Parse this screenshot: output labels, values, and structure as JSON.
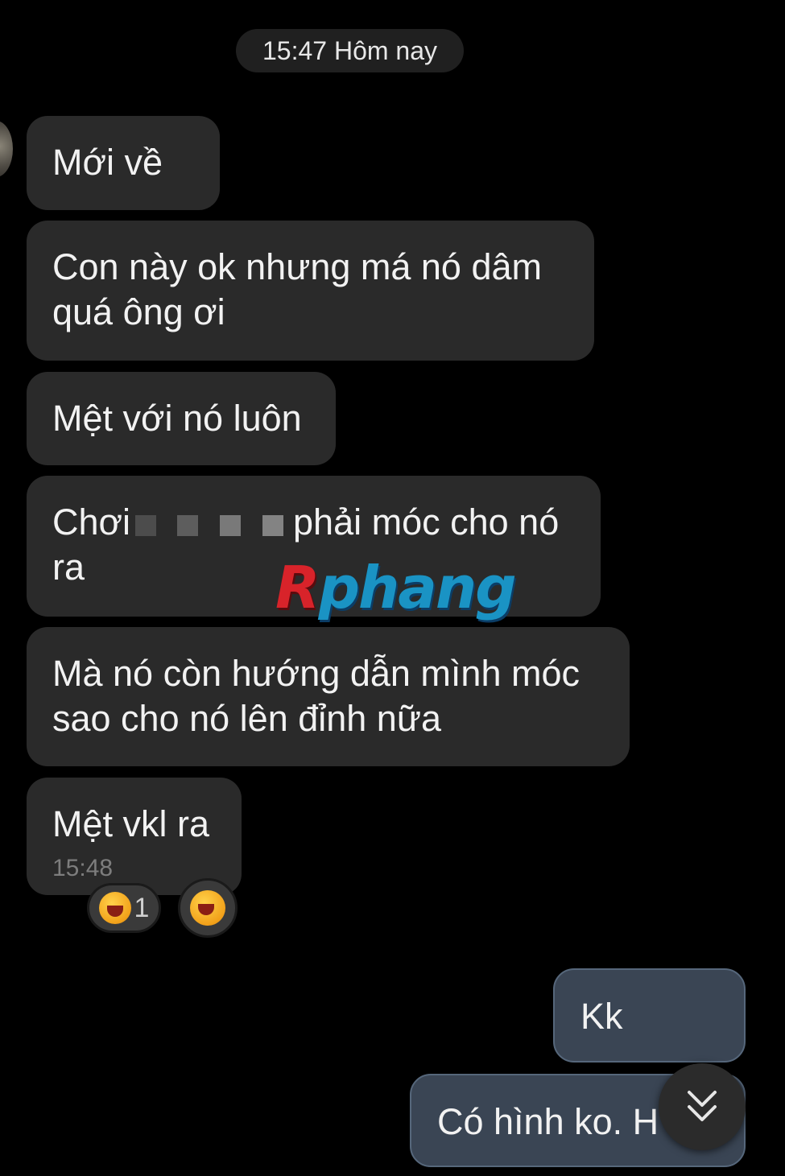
{
  "header": {
    "date_label": "15:47 Hôm nay"
  },
  "messages": [
    {
      "direction": "incoming",
      "text": "Mới về"
    },
    {
      "direction": "incoming",
      "text": "Con này ok nhưng má nó dâm quá ông ơi"
    },
    {
      "direction": "incoming",
      "text": "Mệt với nó luôn"
    },
    {
      "direction": "incoming",
      "text_before": "Chơi",
      "text_after": "phải móc cho nó ra",
      "censored": true
    },
    {
      "direction": "incoming",
      "text": "Mà nó còn hướng dẫn mình móc sao cho nó lên đỉnh nữa"
    },
    {
      "direction": "incoming",
      "text": "Mệt vkl ra",
      "time": "15:48"
    },
    {
      "direction": "outgoing",
      "text": "Kk"
    },
    {
      "direction": "outgoing",
      "text": "Có hình ko. H"
    }
  ],
  "reactions": [
    {
      "icon": "laughing-emoji-icon",
      "count": "1"
    },
    {
      "icon": "laughing-emoji-icon"
    }
  ],
  "watermark": {
    "first_letter": "R",
    "rest": "phang"
  },
  "colors": {
    "background": "#000000",
    "incoming_bubble": "#2a2a2a",
    "outgoing_bubble": "#3a4554"
  },
  "controls": {
    "scroll_icon": "double-chevron-down-icon"
  }
}
